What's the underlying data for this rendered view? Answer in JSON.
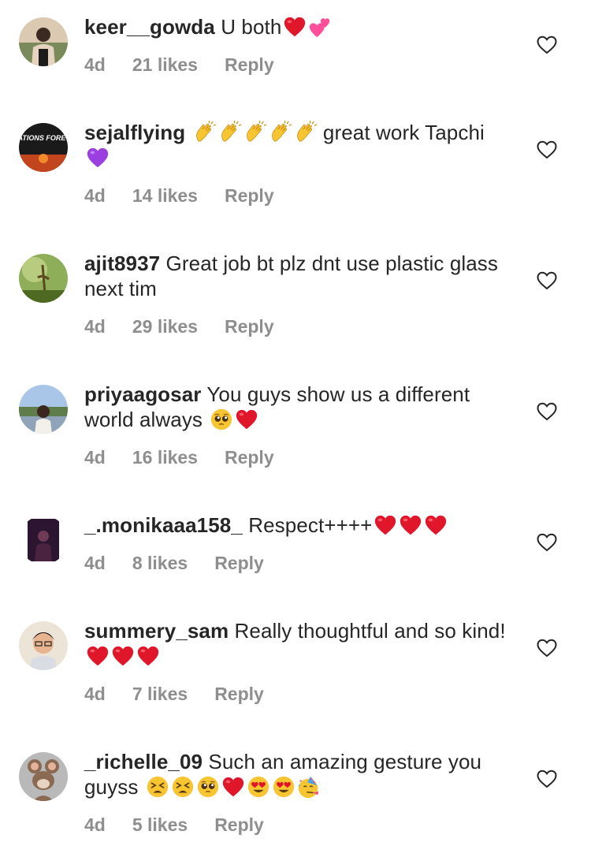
{
  "comments": [
    {
      "username": "keer__gowda",
      "text": "U both",
      "emojis": [
        "red-heart",
        "two-hearts"
      ],
      "age": "4d",
      "likes": "21 likes",
      "reply": "Reply"
    },
    {
      "username": "sejalflying",
      "text": " great work Tapchi",
      "emojis_before": [
        "clapping-hands",
        "clapping-hands",
        "clapping-hands",
        "clapping-hands",
        "clapping-hands"
      ],
      "emojis": [
        "purple-heart"
      ],
      "age": "4d",
      "likes": "14 likes",
      "reply": "Reply"
    },
    {
      "username": "ajit8937",
      "text": "Great job bt plz dnt use plastic glass next tim",
      "emojis": [],
      "age": "4d",
      "likes": "29 likes",
      "reply": "Reply"
    },
    {
      "username": "priyaagosar",
      "text": "You guys show us a different world always",
      "emojis": [
        "pleading-face",
        "red-heart"
      ],
      "age": "4d",
      "likes": "16 likes",
      "reply": "Reply"
    },
    {
      "username": "_.monikaaa158_",
      "text": "Respect++++",
      "emojis": [
        "red-heart",
        "red-heart",
        "red-heart"
      ],
      "age": "4d",
      "likes": "8 likes",
      "reply": "Reply"
    },
    {
      "username": "summery_sam",
      "text": "Really thoughtful and so kind!",
      "emojis": [
        "red-heart",
        "red-heart",
        "red-heart"
      ],
      "age": "4d",
      "likes": "7 likes",
      "reply": "Reply"
    },
    {
      "username": "_richelle_09",
      "text": "Such an amazing gesture you guyss",
      "emojis": [
        "tired-face",
        "tired-face",
        "pleading-face",
        "red-heart",
        "heart-eyes",
        "heart-eyes",
        "partying-face"
      ],
      "age": "4d",
      "likes": "5 likes",
      "reply": "Reply"
    }
  ],
  "avatar_labels": {
    "sejalflying": "AVIATIONS FOREVER"
  },
  "colors": {
    "text": "#262626",
    "meta": "#8e8e8e",
    "heart_emoji": "#e0162b",
    "purple_heart": "#9b3fe0",
    "pink_heart": "#ff4f9a",
    "emoji_yellow": "#f7c531"
  }
}
